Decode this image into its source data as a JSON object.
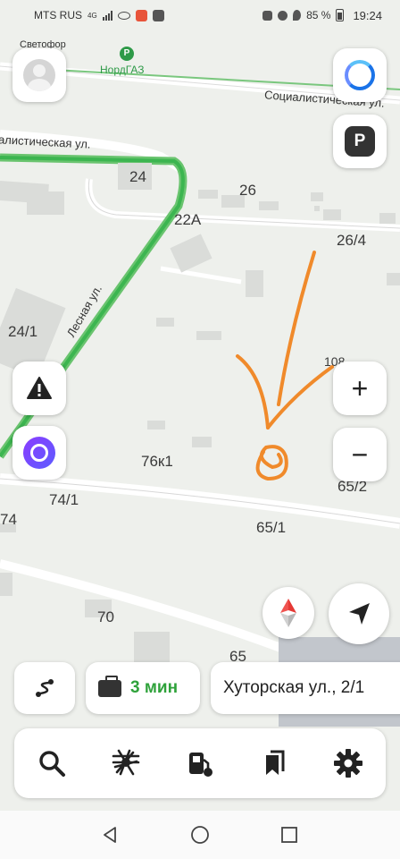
{
  "status_bar": {
    "carrier": "MTS RUS",
    "network": "4G",
    "battery": "85 %",
    "time": "19:24"
  },
  "map": {
    "poi": {
      "svetofor": "Светофор",
      "nordgaz": "НордГАЗ",
      "nordgaz_icon": "fuel-station-icon"
    },
    "streets": {
      "socialisticheskaya_right": "Социалистическая ул.",
      "socialisticheskaya_left": "алистическая ул.",
      "lesnaya": "Лесная ул."
    },
    "house_numbers": {
      "h24": "24",
      "h26": "26",
      "h22a": "22А",
      "h26_4": "26/4",
      "h24_1": "24/1",
      "h10x": "108",
      "h76k1": "76к1",
      "h74_1": "74/1",
      "h65_2": "65/2",
      "h74": "74",
      "h65_1": "65/1",
      "h70": "70",
      "h65": "65"
    },
    "accent_route_color": "#3cb550",
    "drawing_color": "#f08a2b"
  },
  "controls": {
    "profile_icon": "avatar-icon",
    "alisa_top_icon": "alisa-assistant-icon",
    "parking_label": "P",
    "road_events_icon": "warning-icon",
    "alisa_icon": "alisa-icon",
    "zoom_in_label": "+",
    "zoom_out_label": "−",
    "compass_icon": "compass-icon",
    "locate_icon": "navigation-arrow-icon"
  },
  "bottom": {
    "route_icon": "route-icon",
    "travel_time": "3 мин",
    "address": "Хуторская ул., 2/1"
  },
  "toolbar": {
    "items": [
      {
        "name": "search-icon"
      },
      {
        "name": "traffic-icon"
      },
      {
        "name": "fuel-icon"
      },
      {
        "name": "bookmarks-icon"
      },
      {
        "name": "settings-icon"
      }
    ]
  },
  "nav_bar": {
    "items": [
      "back-icon",
      "home-icon",
      "recents-icon"
    ]
  }
}
